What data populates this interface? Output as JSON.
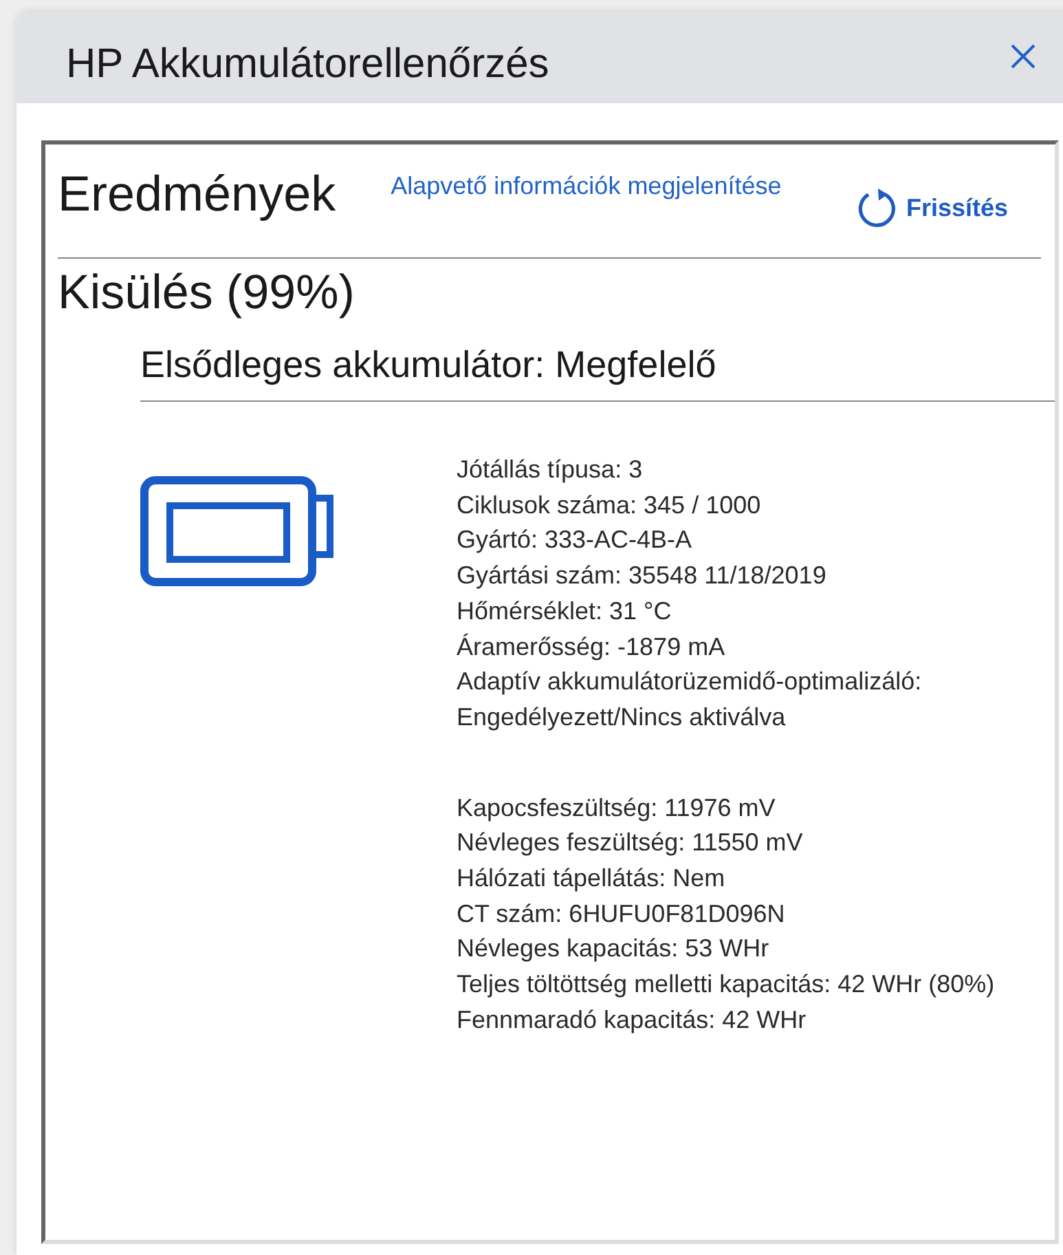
{
  "window": {
    "title": "HP Akkumulátorellenőrzés"
  },
  "results": {
    "title": "Eredmények",
    "link": "Alapvető információk megjelenítése",
    "refresh_button": "Frissítés"
  },
  "status": "Kisülés (99%)",
  "battery": {
    "title": "Elsődleges akkumulátor: Megfelelő",
    "detail_groups": [
      [
        "Jótállás típusa: 3",
        "Ciklusok száma: 345 / 1000",
        "Gyártó: 333-AC-4B-A",
        "Gyártási szám: 35548 11/18/2019",
        "Hőmérséklet: 31 °C",
        "Áramerősség: -1879 mA",
        "Adaptív akkumulátorüzemidő-optimalizáló: Engedélyezett/Nincs aktiválva"
      ],
      [
        "Kapocsfeszültség: 11976 mV",
        "Névleges feszültség: 11550 mV",
        "Hálózati tápellátás: Nem",
        "CT szám: 6HUFU0F81D096N",
        "Névleges kapacitás: 53 WHr",
        "Teljes töltöttség melletti kapacitás: 42 WHr (80%)",
        "Fennmaradó kapacitás: 42 WHr"
      ]
    ]
  }
}
